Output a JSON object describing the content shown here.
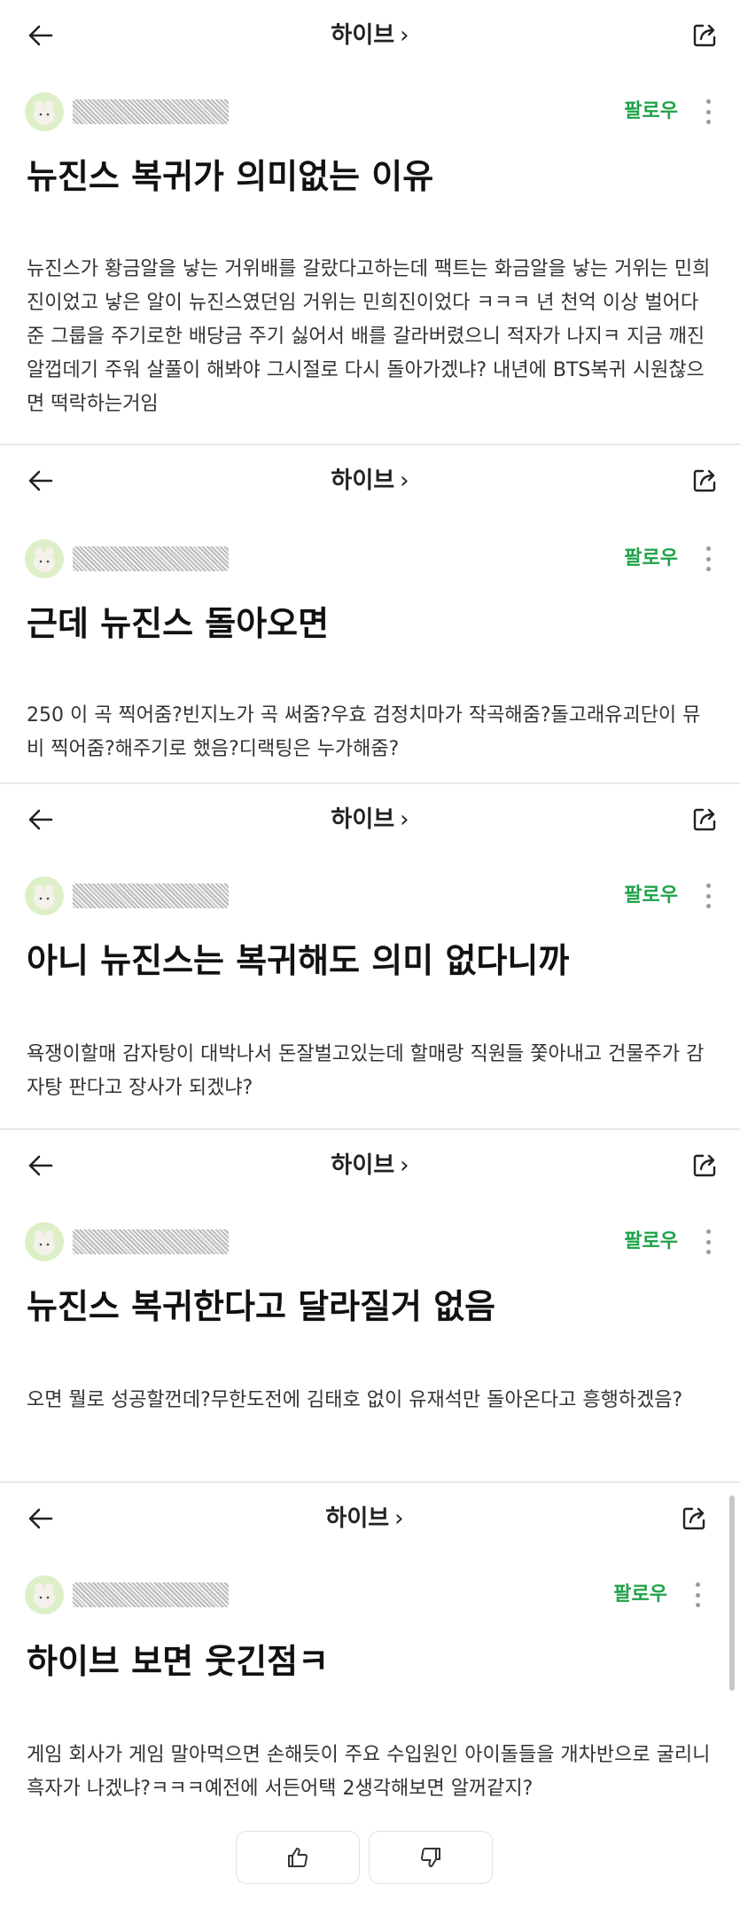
{
  "posts": [
    {
      "board": "하이브",
      "follow_label": "팔로우",
      "title": "뉴진스 복귀가 의미없는 이유",
      "body": "뉴진스가 황금알을 낳는 거위배를 갈랐다고하는데 팩트는 화금알을 낳는 거위는 민희진이었고 낳은 알이 뉴진스였던임 거위는 민희진이었다 ㅋㅋㅋ 년 천억 이상 벌어다준 그룹을 주기로한 배당금 주기 싫어서 배를 갈라버렸으니 적자가 나지ㅋ 지금 깨진 알껍데기 주워 살풀이 해봐야 그시절로 다시 돌아가겠냐? 내년에 BTS복귀 시원찮으면 떡락하는거임"
    },
    {
      "board": "하이브",
      "follow_label": "팔로우",
      "title": "근데 뉴진스 돌아오면",
      "body": "250 이 곡 찍어줌?빈지노가 곡 써줌?우효 검정치마가 작곡해줌?돌고래유괴단이 뮤비 찍어줌?해주기로 했음?디랙팅은 누가해줌?"
    },
    {
      "board": "하이브",
      "follow_label": "팔로우",
      "title": "아니 뉴진스는 복귀해도 의미 없다니까",
      "body": "욕쟁이할매 감자탕이 대박나서 돈잘벌고있는데 할매랑 직원들  쫓아내고 건물주가 감자탕 판다고 장사가 되겠냐?"
    },
    {
      "board": "하이브",
      "follow_label": "팔로우",
      "title": "뉴진스 복귀한다고 달라질거 없음",
      "body": "오면 뭘로 성공할껀데?무한도전에 김태호 없이 유재석만 돌아온다고 흥행하겠음?"
    },
    {
      "board": "하이브",
      "follow_label": "팔로우",
      "title": "하이브 보면 웃긴점ㅋ",
      "body": "게임 회사가 게임 말아먹으면 손해듯이 주요 수입원인 아이돌들을 개차반으로 굴리니 흑자가 나겠냐?ㅋㅋㅋ예전에 서든어택 2생각해보면 알꺼같지?"
    }
  ],
  "icons": {
    "back": "arrow-left-icon",
    "share": "share-icon",
    "more": "more-vertical-icon",
    "like": "thumbs-up-icon",
    "dislike": "thumbs-down-icon"
  },
  "colors": {
    "follow": "#1fa24a",
    "divider": "#e9e9e9"
  }
}
